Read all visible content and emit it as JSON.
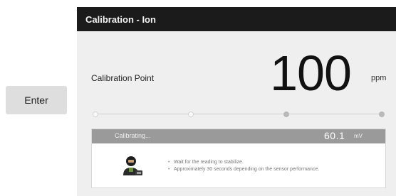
{
  "enter_button": {
    "label": "Enter"
  },
  "panel": {
    "title": "Calibration - Ion",
    "calibration_point_label": "Calibration Point",
    "calibration_value": "100",
    "calibration_unit": "ppm",
    "steps": [
      {
        "state": "active"
      },
      {
        "state": "active"
      },
      {
        "state": "inactive"
      },
      {
        "state": "inactive"
      }
    ],
    "status": {
      "text": "Calibrating...",
      "reading": "60.1",
      "reading_unit": "mV",
      "icon": "user-with-sensor-icon",
      "tips": [
        "Wait for the reading to stabilize.",
        "Approximately 30 seconds depending on the sensor performance."
      ]
    }
  }
}
